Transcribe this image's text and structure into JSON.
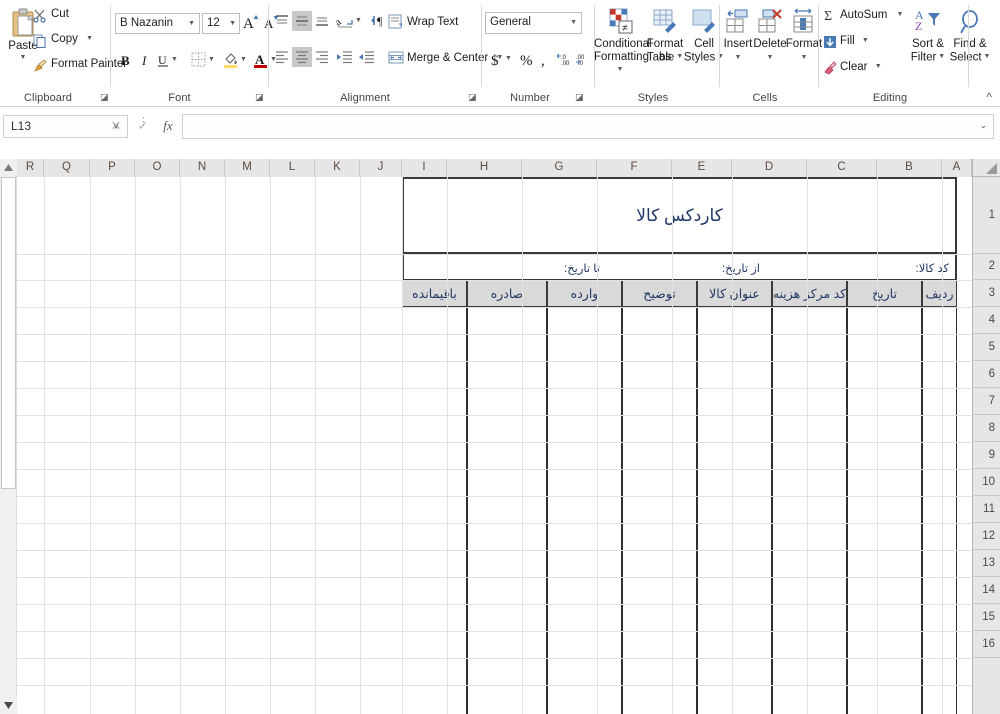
{
  "app": {
    "name": "Microsoft Excel",
    "namebox_value": "L13",
    "formula_value": "",
    "collapse_ribbon_glyph": "^"
  },
  "ribbon": {
    "groups": [
      {
        "name": "Clipboard",
        "label": "Clipboard",
        "items": [
          {
            "label": "Paste",
            "icon": "clipboard-icon",
            "has_menu": true
          },
          {
            "label": "Cut",
            "icon": "scissors-icon",
            "has_menu": false
          },
          {
            "label": "Copy",
            "icon": "copy-icon",
            "has_menu": true
          },
          {
            "label": "Format Painter",
            "icon": "paintbrush-icon",
            "has_menu": false
          }
        ]
      },
      {
        "name": "Font",
        "label": "Font",
        "font_name": "B Nazanin",
        "font_size": "12",
        "items": [
          {
            "label": "Grow Font",
            "icon": "grow-font-icon"
          },
          {
            "label": "Shrink Font",
            "icon": "shrink-font-icon"
          },
          {
            "label": "Bold",
            "icon": "bold-icon"
          },
          {
            "label": "Italic",
            "icon": "italic-icon"
          },
          {
            "label": "Underline",
            "icon": "underline-icon"
          },
          {
            "label": "Borders",
            "icon": "borders-icon"
          },
          {
            "label": "Fill Color",
            "icon": "fill-color-icon"
          },
          {
            "label": "Font Color",
            "icon": "font-color-icon"
          }
        ]
      },
      {
        "name": "Alignment",
        "label": "Alignment",
        "items": [
          {
            "label": "Top Align",
            "icon": "align-top-icon"
          },
          {
            "label": "Middle Align",
            "icon": "align-middle-icon"
          },
          {
            "label": "Bottom Align",
            "icon": "align-bottom-icon"
          },
          {
            "label": "Orientation",
            "icon": "orientation-icon"
          },
          {
            "label": "Text Direction",
            "icon": "text-direction-icon"
          },
          {
            "label": "Align Left",
            "icon": "align-left-icon"
          },
          {
            "label": "Center",
            "icon": "align-center-icon"
          },
          {
            "label": "Align Right",
            "icon": "align-right-icon"
          },
          {
            "label": "Increase Indent",
            "icon": "increase-indent-icon"
          },
          {
            "label": "Decrease Indent",
            "icon": "decrease-indent-icon"
          },
          {
            "label": "Wrap Text",
            "icon": "wrap-text-icon"
          },
          {
            "label": "Merge & Center",
            "icon": "merge-center-icon"
          }
        ],
        "wrap_text_label": "Wrap Text",
        "merge_center_label": "Merge & Center"
      },
      {
        "name": "Number",
        "label": "Number",
        "format_value": "General",
        "items": [
          {
            "label": "Accounting Number Format",
            "icon": "currency-icon"
          },
          {
            "label": "Percent Style",
            "icon": "percent-icon"
          },
          {
            "label": "Comma Style",
            "icon": "comma-icon"
          },
          {
            "label": "Increase Decimal",
            "icon": "increase-decimal-icon"
          },
          {
            "label": "Decrease Decimal",
            "icon": "decrease-decimal-icon"
          }
        ]
      },
      {
        "name": "Styles",
        "label": "Styles",
        "items": [
          {
            "label_line1": "Conditional",
            "label_line2": "Formatting",
            "icon": "conditional-formatting-icon"
          },
          {
            "label_line1": "Format as",
            "label_line2": "Table",
            "icon": "format-as-table-icon"
          },
          {
            "label_line1": "Cell",
            "label_line2": "Styles",
            "icon": "cell-styles-icon"
          }
        ]
      },
      {
        "name": "Cells",
        "label": "Cells",
        "items": [
          {
            "label": "Insert",
            "icon": "insert-cells-icon"
          },
          {
            "label": "Delete",
            "icon": "delete-cells-icon"
          },
          {
            "label": "Format",
            "icon": "format-cells-icon"
          }
        ]
      },
      {
        "name": "Editing",
        "label": "Editing",
        "items": [
          {
            "label": "AutoSum",
            "icon": "autosum-icon"
          },
          {
            "label": "Fill",
            "icon": "fill-icon"
          },
          {
            "label": "Clear",
            "icon": "clear-icon"
          },
          {
            "label_line1": "Sort &",
            "label_line2": "Filter",
            "icon": "sort-filter-icon"
          },
          {
            "label_line1": "Find &",
            "label_line2": "Select",
            "icon": "find-select-icon"
          }
        ]
      }
    ]
  },
  "sheet": {
    "column_headers": [
      "R",
      "Q",
      "P",
      "O",
      "N",
      "M",
      "L",
      "K",
      "J",
      "I",
      "H",
      "G",
      "F",
      "E",
      "D",
      "C",
      "B",
      "A"
    ],
    "row_headers": [
      "1",
      "2",
      "3",
      "4",
      "5",
      "6",
      "7",
      "8",
      "9",
      "10",
      "11",
      "12",
      "13",
      "14",
      "15",
      "16"
    ],
    "direction": "rtl"
  },
  "kardex": {
    "title": "کاردکس کالا",
    "subheaders": [
      {
        "key": "item_code",
        "label": "کد کالا:"
      },
      {
        "key": "from_date",
        "label": "از تاریخ:"
      },
      {
        "key": "to_date",
        "label": "تا تاریخ:"
      }
    ],
    "columns": [
      {
        "key": "row_no",
        "label": "ردیف"
      },
      {
        "key": "date",
        "label": "تاریخ"
      },
      {
        "key": "cost_center",
        "label": "کد مرکز هزینه"
      },
      {
        "key": "item_name",
        "label": "عنوان کالا"
      },
      {
        "key": "description",
        "label": "توضیح"
      },
      {
        "key": "received",
        "label": "وارده"
      },
      {
        "key": "issued",
        "label": "صادره"
      },
      {
        "key": "balance",
        "label": "باقیمانده"
      }
    ],
    "rows": [],
    "colors": {
      "header_fill": "#d9d9d9",
      "text": "#1f3864",
      "border": "#2f2f2f"
    }
  }
}
